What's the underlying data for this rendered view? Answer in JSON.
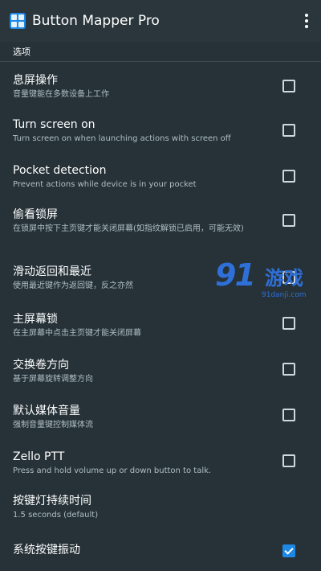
{
  "app": {
    "title": "Button Mapper Pro"
  },
  "section": {
    "label": "选项"
  },
  "settings": [
    {
      "title": "息屏操作",
      "summary": "音量键能在多数设备上工作",
      "checked": false
    },
    {
      "title": "Turn screen on",
      "summary": "Turn screen on when launching actions with screen off",
      "checked": false
    },
    {
      "title": "Pocket detection",
      "summary": "Prevent actions while device is in your pocket",
      "checked": false
    },
    {
      "title": "偷看锁屏",
      "summary": "在锁屏中按下主页键才能关闭屏幕(如指纹解锁已启用，可能无效)",
      "checked": false
    },
    {
      "title": "滑动返回和最近",
      "summary": "使用最近键作为返回键，反之亦然",
      "checked": false
    },
    {
      "title": "主屏幕锁",
      "summary": "在主屏幕中点击主页键才能关闭屏幕",
      "checked": false
    },
    {
      "title": "交换卷方向",
      "summary": "基于屏幕旋转调整方向",
      "checked": false
    },
    {
      "title": "默认媒体音量",
      "summary": "强制音量键控制媒体流",
      "checked": false
    },
    {
      "title": "Zello PTT",
      "summary": "Press and hold volume up or down button to talk.",
      "checked": false
    },
    {
      "title": "按键灯持续时间",
      "summary": "1.5 seconds (default)",
      "checked": null
    },
    {
      "title": "系统按键振动",
      "summary": "",
      "checked": true
    }
  ],
  "watermark": {
    "logo": "91",
    "name": "游戏",
    "url": "91danji.com"
  },
  "colors": {
    "background": "#263238",
    "accent": "#1e88e5",
    "watermark": "#2f6fd8"
  }
}
